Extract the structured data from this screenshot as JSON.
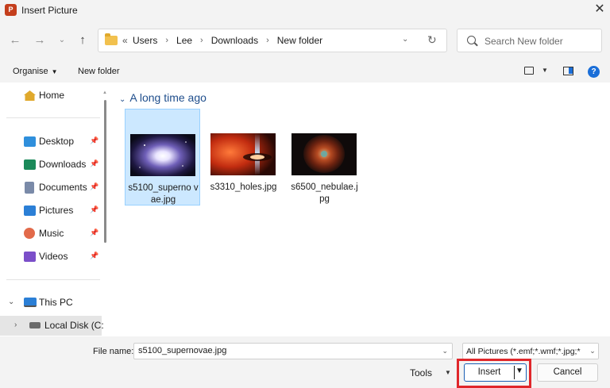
{
  "window": {
    "title": "Insert Picture",
    "app_icon_letter": "P"
  },
  "nav": {
    "back_icon": "arrow-left-icon",
    "forward_icon": "arrow-right-icon",
    "recent_icon": "chevron-down-icon",
    "up_icon": "arrow-up-icon",
    "path_prefix": "«",
    "breadcrumbs": [
      "Users",
      "Lee",
      "Downloads",
      "New folder"
    ],
    "search_placeholder": "Search New folder"
  },
  "toolbar": {
    "organise_label": "Organise",
    "new_folder_label": "New folder"
  },
  "sidebar": {
    "home": "Home",
    "quick_access": [
      {
        "label": "Desktop",
        "icon": "desktop-icon",
        "color": "#2f8fdc"
      },
      {
        "label": "Downloads",
        "icon": "download-icon",
        "color": "#1b8a5a"
      },
      {
        "label": "Documents",
        "icon": "document-icon",
        "color": "#7a8aa8"
      },
      {
        "label": "Pictures",
        "icon": "pictures-icon",
        "color": "#2b7fd6"
      },
      {
        "label": "Music",
        "icon": "music-icon",
        "color": "#e26a4a"
      },
      {
        "label": "Videos",
        "icon": "video-icon",
        "color": "#7b4fc9"
      }
    ],
    "this_pc": "This PC",
    "local_disk": "Local Disk (C:"
  },
  "content": {
    "group_title": "A long time ago",
    "files": [
      {
        "name": "s5100_supernovae.jpg",
        "display": "s5100_superno vae.jpg",
        "selected": true
      },
      {
        "name": "s3310_holes.jpg",
        "display": "s3310_holes.jpg",
        "selected": false
      },
      {
        "name": "s6500_nebulae.jpg",
        "display": "s6500_nebulae.j pg",
        "selected": false
      }
    ]
  },
  "footer": {
    "file_name_label": "File name:",
    "file_name_value": "s5100_supernovae.jpg",
    "file_type_value": "All Pictures (*.emf;*.wmf;*.jpg;*",
    "tools_label": "Tools",
    "insert_label": "Insert",
    "cancel_label": "Cancel"
  }
}
